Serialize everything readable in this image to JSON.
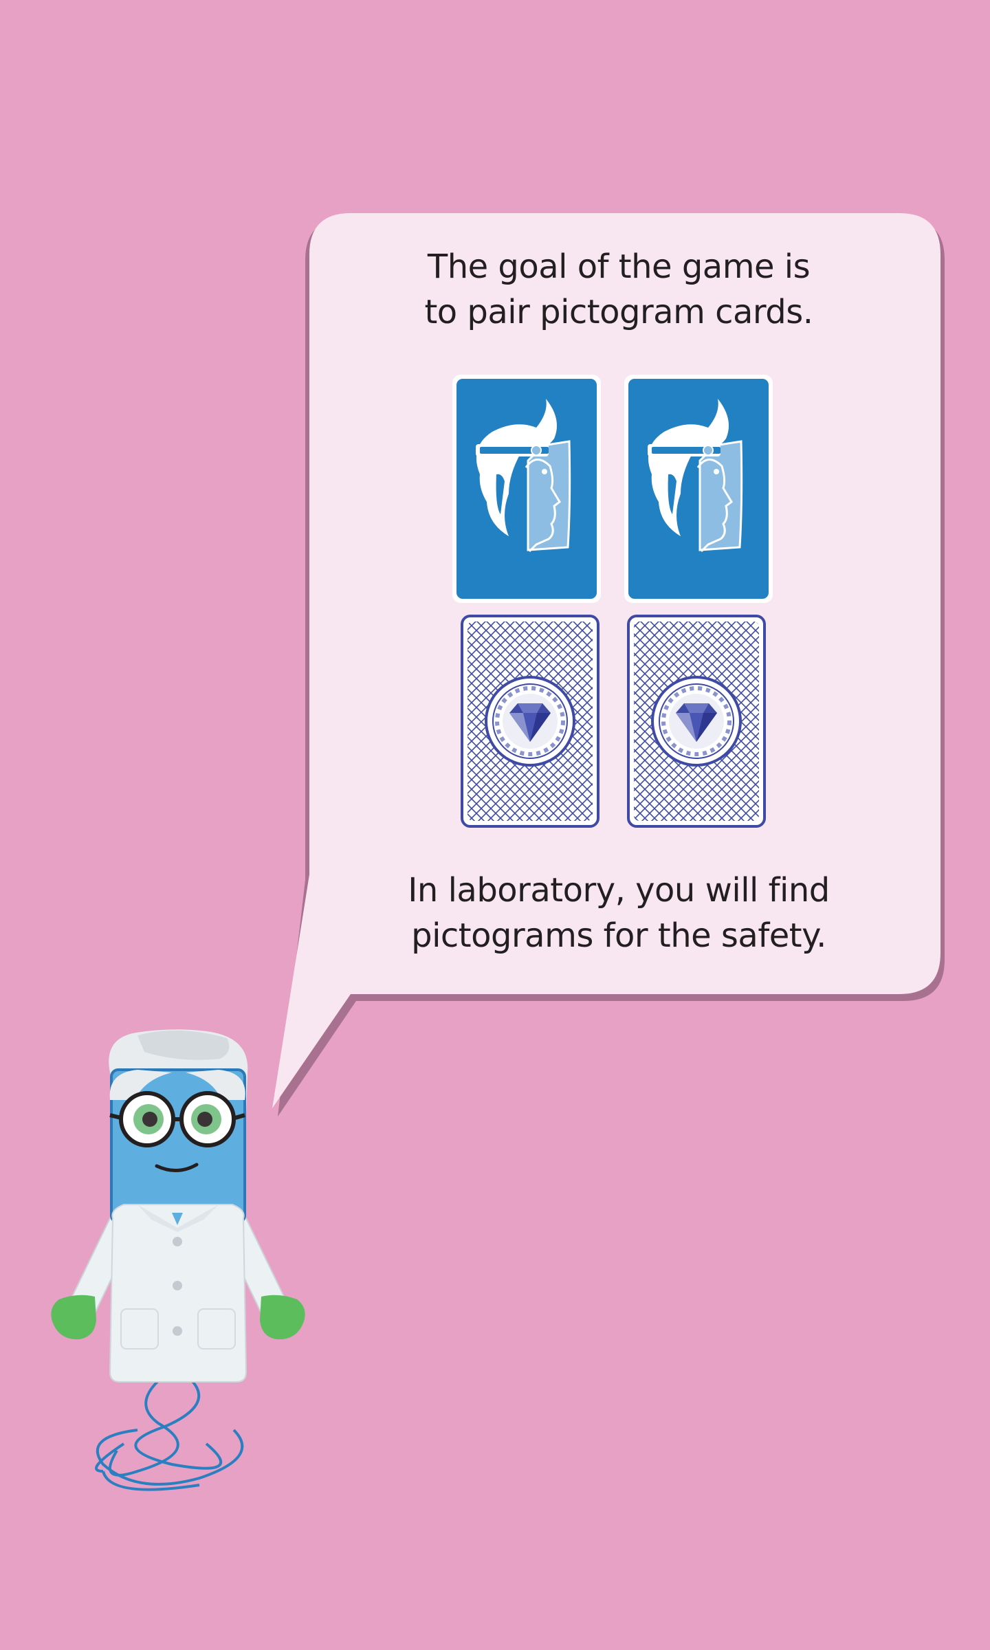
{
  "speech_bubble": {
    "intro_lines": [
      "The goal of the game is",
      "to pair pictogram cards."
    ],
    "outro_lines": [
      "In laboratory, you will find",
      "pictograms for the safety."
    ]
  },
  "cards": {
    "face_up": [
      {
        "pictogram": "face-shield-icon"
      },
      {
        "pictogram": "face-shield-icon"
      }
    ],
    "face_down": [
      {
        "emblem": "diamond-dna-emblem-icon"
      },
      {
        "emblem": "diamond-dna-emblem-icon"
      }
    ]
  },
  "colors": {
    "background": "#e7a1c5",
    "bubble": "#f8e7f0",
    "bubble_shadow": "#a8718f",
    "card_front": "#2181c2",
    "card_back_line": "#3e4aa3",
    "mascot_face": "#5faee0",
    "mascot_gloves": "#5bbd5b"
  }
}
